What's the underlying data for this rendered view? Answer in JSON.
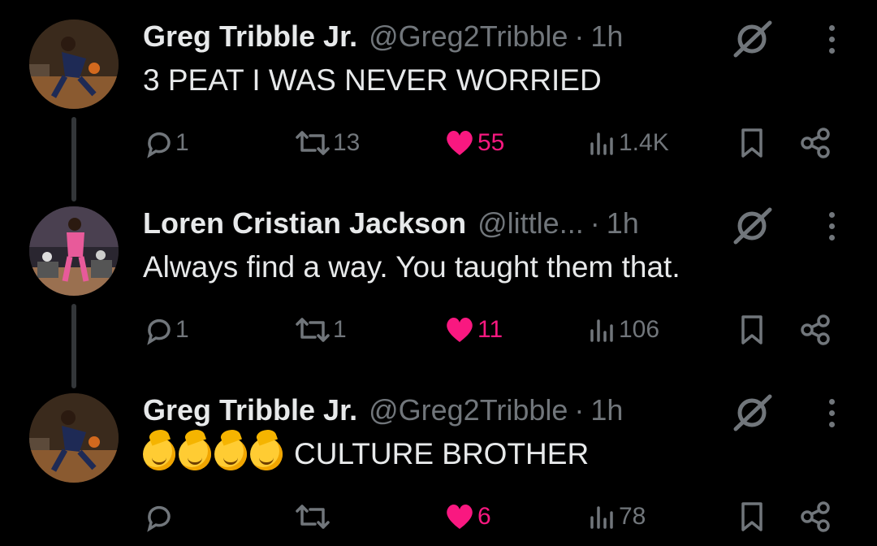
{
  "tweets": [
    {
      "name": "Greg Tribble Jr.",
      "handle": "@Greg2Tribble",
      "separator": "·",
      "time": "1h",
      "text": "3 PEAT I WAS NEVER WORRIED",
      "emoji_count": 0,
      "replies": "1",
      "reposts": "13",
      "likes": "55",
      "views": "1.4K",
      "liked": true
    },
    {
      "name": "Loren Cristian Jackson",
      "handle": "@little...",
      "separator": "·",
      "time": "1h",
      "text": "Always find a way. You taught them that.",
      "emoji_count": 0,
      "replies": "1",
      "reposts": "1",
      "likes": "11",
      "views": "106",
      "liked": true
    },
    {
      "name": "Greg Tribble Jr.",
      "handle": "@Greg2Tribble",
      "separator": "·",
      "time": "1h",
      "text": "CULTURE BROTHER",
      "emoji_count": 4,
      "replies": "",
      "reposts": "",
      "likes": "6",
      "views": "78",
      "liked": true
    }
  ],
  "icons": {
    "reply": "reply-icon",
    "repost": "repost-icon",
    "like": "heart-icon",
    "views": "views-icon",
    "bookmark": "bookmark-icon",
    "share": "share-icon",
    "grok": "grok-icon",
    "more": "more-icon"
  },
  "colors": {
    "background": "#000000",
    "text": "#e7e9ea",
    "muted": "#71767b",
    "like": "#f91880"
  }
}
